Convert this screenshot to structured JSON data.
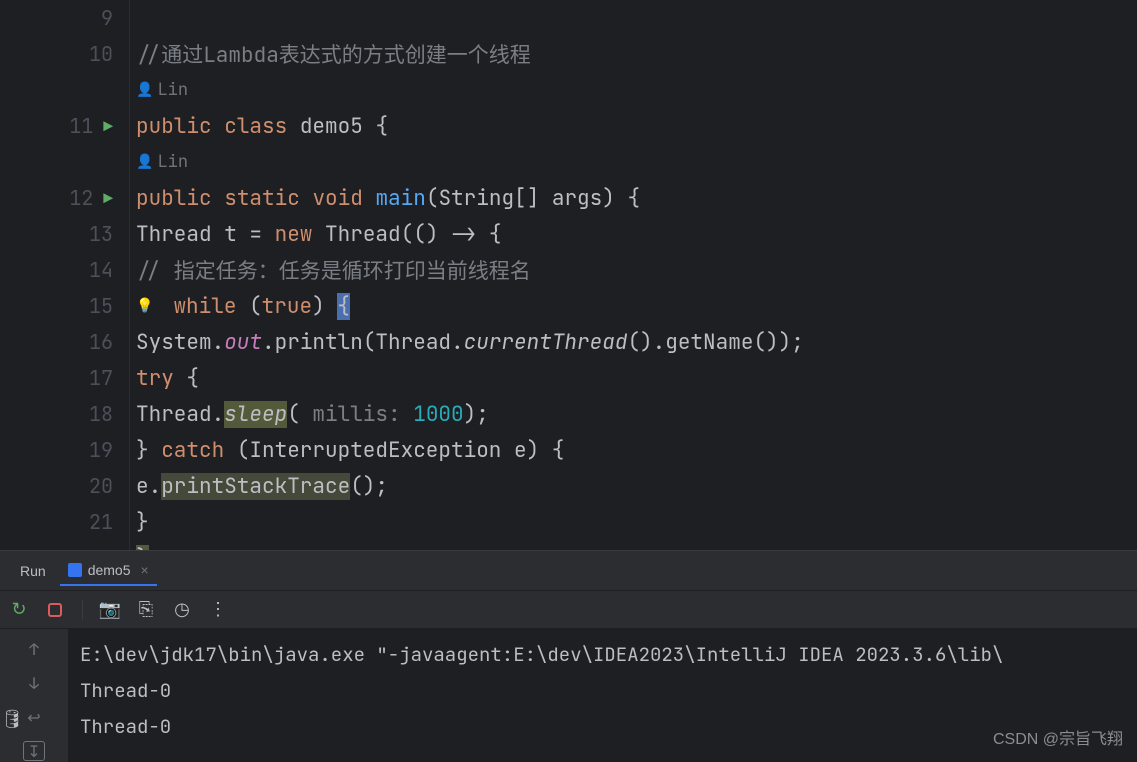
{
  "code": {
    "author": "Lin",
    "lines": {
      "l9": "9",
      "l10": "10",
      "l11": "11",
      "l12": "12",
      "l13": "13",
      "l14": "14",
      "l15": "15",
      "l16": "16",
      "l17": "17",
      "l18": "18",
      "l19": "19",
      "l20": "20",
      "l21": "21"
    },
    "tokens": {
      "comment10": "//通过Lambda表达式的方式创建一个线程",
      "public": "public",
      "class": "class",
      "demo5": "demo5",
      "lbrace": "{",
      "static": "static",
      "void": "void",
      "main": "main",
      "main_params": "(String[] args) {",
      "thread_decl": "Thread t = ",
      "new": "new",
      "thread_ctor": " Thread(() -> {",
      "comment14": "// 指定任务：任务是循环打印当前线程名",
      "while": "while",
      "true": "true",
      "lparen": "(",
      "rparen": ")",
      "space_lbrace": " {",
      "sys": "System.",
      "out": "out",
      "println": ".println(Thread.",
      "currentThread": "currentThread",
      "getName": "().getName());",
      "try": "try",
      "try_brace": " {",
      "thread_dot": "Thread.",
      "sleep": "sleep",
      "sleep_open": "(",
      "millis_hint": " millis: ",
      "thousand": "1000",
      "sleep_close": ");",
      "catch_close": "} ",
      "catch": "catch",
      "catch_params": " (InterruptedException e) {",
      "e_dot": "e.",
      "printStackTrace": "printStackTrace",
      "call_close": "();",
      "rbrace": "}"
    }
  },
  "run": {
    "label": "Run",
    "tab": "demo5",
    "console": {
      "cmd": "E:\\dev\\jdk17\\bin\\java.exe \"-javaagent:E:\\dev\\IDEA2023\\IntelliJ IDEA 2023.3.6\\lib\\",
      "out1": "Thread-0",
      "out2": "Thread-0"
    }
  },
  "watermark": "CSDN @宗旨飞翔"
}
